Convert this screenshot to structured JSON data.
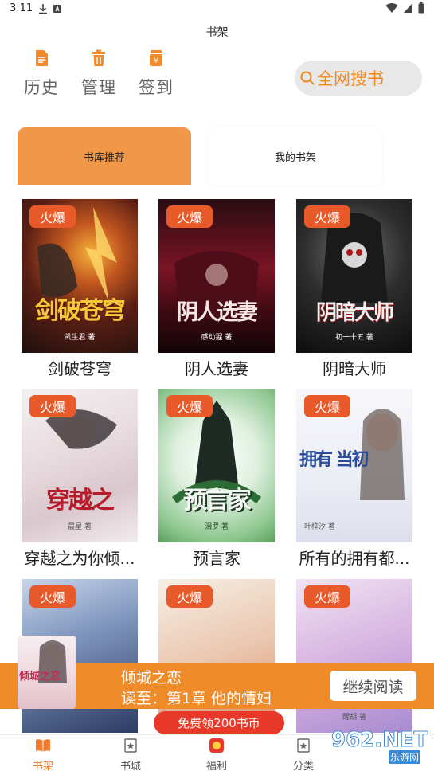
{
  "status_bar": {
    "time": "3:11"
  },
  "header": {
    "title": "书架"
  },
  "quick_actions": [
    {
      "label": "历史",
      "icon": "document-icon"
    },
    {
      "label": "管理",
      "icon": "trash-icon"
    },
    {
      "label": "签到",
      "icon": "coin-jar-icon"
    }
  ],
  "search": {
    "label": "全网搜书"
  },
  "tabs": [
    {
      "label": "书库推荐",
      "active": true
    },
    {
      "label": "我的书架",
      "active": false
    }
  ],
  "badge_text": "火爆",
  "books": [
    {
      "title": "剑破苍穹",
      "cover_title": "剑破苍穹",
      "cover_author": "凯生君 著"
    },
    {
      "title": "阴人选妻",
      "cover_title": "阴人选妻",
      "cover_author": "感动猩 著"
    },
    {
      "title": "阴暗大师",
      "cover_title": "阴暗大师",
      "cover_author": "初一十五 著"
    },
    {
      "title": "穿越之为你倾...",
      "cover_title": "穿越之",
      "cover_author": "晨星 著"
    },
    {
      "title": "预言家",
      "cover_title": "预言家",
      "cover_author": "泪罗 著"
    },
    {
      "title": "所有的拥有都...",
      "cover_title": "拥有 当初",
      "cover_author": "叶梓汐 著"
    },
    {
      "title": "",
      "cover_title": "",
      "cover_author": ""
    },
    {
      "title": "",
      "cover_title": "",
      "cover_author": ""
    },
    {
      "title": "",
      "cover_title": "",
      "cover_author": "醒胡 著"
    }
  ],
  "continue_reading": {
    "book_name": "倾城之恋",
    "progress_text": "读至：第1章 他的情妇",
    "button_label": "继续阅读",
    "cover_title": "倾城之恋"
  },
  "promo": {
    "label": "免费领200书币"
  },
  "bottom_nav": [
    {
      "label": "书架",
      "icon": "book-open-icon",
      "active": true
    },
    {
      "label": "书城",
      "icon": "star-book-icon",
      "active": false
    },
    {
      "label": "福利",
      "icon": "gift-icon",
      "active": false
    },
    {
      "label": "分类",
      "icon": "star-book-icon",
      "active": false
    }
  ],
  "watermark": {
    "number": "962.NET",
    "sub": "乐游网"
  },
  "colors": {
    "accent": "#f09848",
    "badge": "#e85a2a",
    "banner": "#f08b2a",
    "promo": "#e83828"
  }
}
